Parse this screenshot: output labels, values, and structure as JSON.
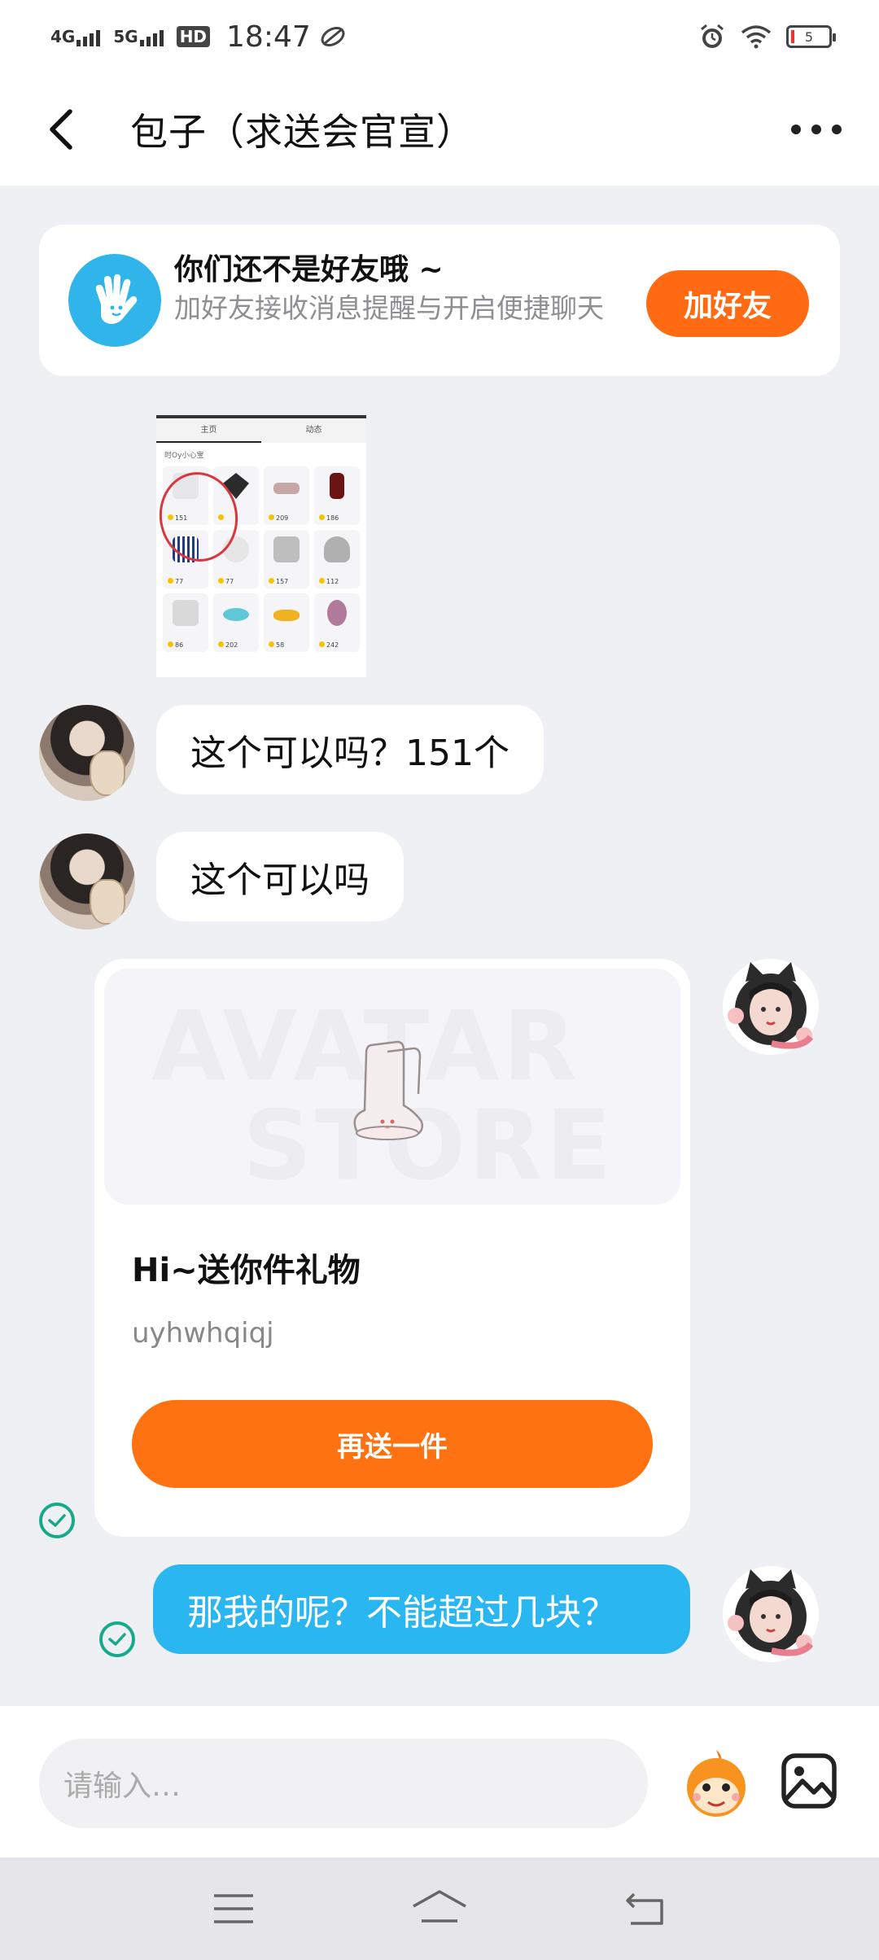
{
  "status_bar": {
    "net1": "4G",
    "net2": "5G",
    "hd": "HD",
    "time": "18:47",
    "battery": "5"
  },
  "header": {
    "title": "包子（求送会官宣）"
  },
  "friend_banner": {
    "title": "你们还不是好友哦 ~",
    "subtitle": "加好友接收消息提醒与开启便捷聊天",
    "button": "加好友"
  },
  "shared_image": {
    "tabs": [
      "主页",
      "动态"
    ],
    "subtitle": "时Oy小心宝",
    "prices": [
      "151",
      "",
      "209",
      "186",
      "77",
      "77",
      "157",
      "112",
      "86",
      "202",
      "58",
      "242"
    ]
  },
  "messages": [
    {
      "text": "这个可以吗？151个"
    },
    {
      "text": "这个可以吗"
    },
    {
      "text": "那我的呢？不能超过几块？"
    }
  ],
  "gift_card": {
    "watermark_top": "AVATAR",
    "watermark_bottom": "STORE",
    "title": "Hi~送你件礼物",
    "code": "uyhwhqiqj",
    "button": "再送一件"
  },
  "input": {
    "placeholder": "请输入…"
  },
  "icons": {
    "back": "back-arrow-icon",
    "more": "more-dots-icon",
    "wave": "waving-hand-icon",
    "emoji": "emoji-mascot-icon",
    "image": "image-picker-icon",
    "check": "read-check-icon"
  },
  "colors": {
    "accent_orange": "#ff6a12",
    "bubble_blue": "#29b6f1",
    "check_green": "#19a98a",
    "wave_blue": "#2fb5ea"
  }
}
